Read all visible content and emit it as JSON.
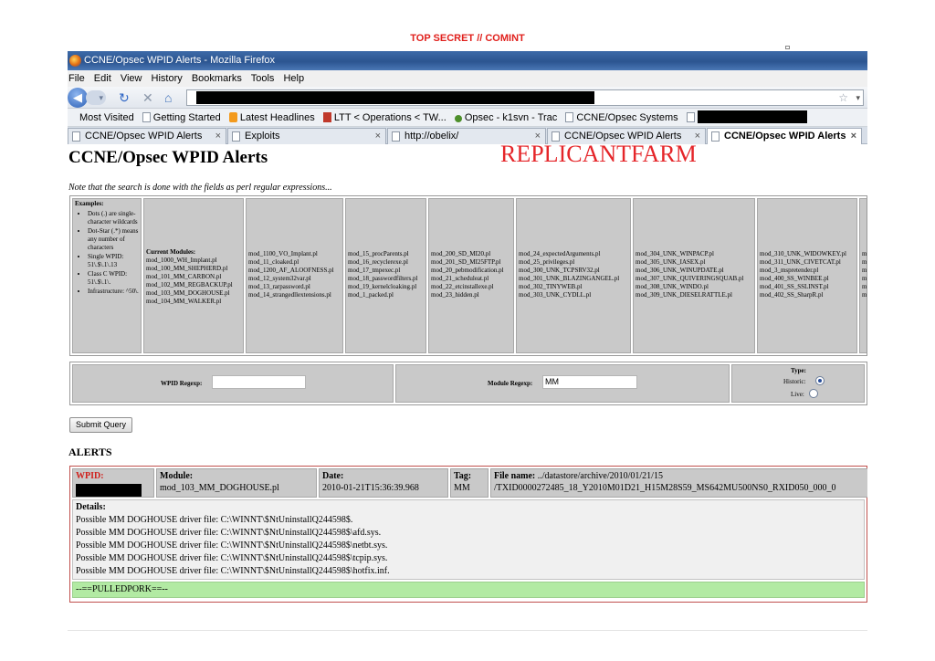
{
  "classification": "TOP SECRET // COMINT",
  "browser": {
    "window_title": "CCNE/Opsec WPID Alerts - Mozilla Firefox",
    "menu": [
      "File",
      "Edit",
      "View",
      "History",
      "Bookmarks",
      "Tools",
      "Help"
    ],
    "bookmarks": [
      "Most Visited",
      "Getting Started",
      "Latest Headlines",
      "LTT < Operations < TW...",
      "Opsec - k1svn - Trac",
      "CCNE/Opsec Systems"
    ],
    "tabs": [
      "CCNE/Opsec WPID Alerts",
      "Exploits",
      "http://obelix/",
      "CCNE/Opsec WPID Alerts",
      "CCNE/Opsec WPID Alerts"
    ],
    "active_tab": 4
  },
  "page": {
    "title": "CCNE/Opsec WPID Alerts",
    "codename": "REPLICANTFARM",
    "note": "Note that the search is done with the fields as perl regular expressions..."
  },
  "examples": {
    "heading": "Examples:",
    "items": [
      "Dots (.) are single-character wildcards",
      "Dot-Star (.*) means any number of characters",
      "Single WPID: 51\\.$\\.1\\.13",
      "Class C WPID: 51\\.$\\.1\\.",
      "Infrastructure: ^50\\."
    ]
  },
  "modules": {
    "heading": "Current Modules:",
    "columns": [
      [
        "mod_1000_WH_Implant.pl",
        "mod_100_MM_SHEPHERD.pl",
        "mod_101_MM_CARBON.pl",
        "mod_102_MM_REGBACKUP.pl",
        "mod_103_MM_DOGHOUSE.pl",
        "mod_104_MM_WALKER.pl"
      ],
      [
        "mod_1100_VO_Implant.pl",
        "mod_11_cloaked.pl",
        "mod_1200_AF_ALOOFNESS.pl",
        "mod_12_system32var.pl",
        "mod_13_rarpassword.pl",
        "mod_14_strangedllextensions.pl"
      ],
      [
        "mod_15_procParents.pl",
        "mod_16_recyclerexe.pl",
        "mod_17_tmpexec.pl",
        "mod_18_passwordfilters.pl",
        "mod_19_kernelcloaking.pl",
        "mod_1_packed.pl"
      ],
      [
        "mod_200_SD_MI20.pl",
        "mod_201_SD_MI25FTP.pl",
        "mod_20_pebmodification.pl",
        "mod_21_scheduleat.pl",
        "mod_22_etcinstallexe.pl",
        "mod_23_hidden.pl"
      ],
      [
        "mod_24_expectedArguments.pl",
        "mod_25_privileges.pl",
        "mod_300_UNK_TCPSRV32.pl",
        "mod_301_UNK_BLAZINGANGEL.pl",
        "mod_302_TINYWEB.pl",
        "mod_303_UNK_CYDLL.pl"
      ],
      [
        "mod_304_UNK_WINPACP.pl",
        "mod_305_UNK_IASEX.pl",
        "mod_306_UNK_WINUPDATE.pl",
        "mod_307_UNK_QUIVERINGSQUAB.pl",
        "mod_308_UNK_WINDO.pl",
        "mod_309_UNK_DIESELRATTLE.pl"
      ],
      [
        "mod_310_UNK_WIDOWKEY.pl",
        "mod_311_UNK_CIVETCAT.pl",
        "mod_3_mspretender.pl",
        "mod_400_SS_WINBEE.pl",
        "mod_401_SS_SSLINST.pl",
        "mod_402_SS_SharpR.pl"
      ],
      [
        "mo",
        "mo",
        "mo",
        "mo",
        "mo",
        "mo"
      ]
    ]
  },
  "search": {
    "wpid_label": "WPID Regexp:",
    "wpid_value": "",
    "module_label": "Module Regexp:",
    "module_value": "MM",
    "type_label": "Type:",
    "historic_label": "Historic:",
    "live_label": "Live:",
    "selected_type": "Historic",
    "submit_label": "Submit Query"
  },
  "alerts": {
    "heading": "ALERTS",
    "items": [
      {
        "wpid_label": "WPID:",
        "module_label": "Module:",
        "module": "mod_103_MM_DOGHOUSE.pl",
        "date_label": "Date:",
        "date": "2010-01-21T15:36:39.968",
        "tag_label": "Tag:",
        "tag": "MM",
        "file_label": "File name:",
        "file_line1": "../datastore/archive/2010/01/21/15",
        "file_line2": "/TXID0000272485_18_Y2010M01D21_H15M28S59_MS642MU500NS0_RXID050_000_0",
        "details_label": "Details:",
        "details": [
          "Possible MM DOGHOUSE driver file: C:\\WINNT\\$NtUninstallQ244598$.",
          "Possible MM DOGHOUSE driver file: C:\\WINNT\\$NtUninstallQ244598$\\afd.sys.",
          "Possible MM DOGHOUSE driver file: C:\\WINNT\\$NtUninstallQ244598$\\netbt.sys.",
          "Possible MM DOGHOUSE driver file: C:\\WINNT\\$NtUninstallQ244598$\\tcpip.sys.",
          "Possible MM DOGHOUSE driver file: C:\\WINNT\\$NtUninstallQ244598$\\hotfix.inf."
        ],
        "footer": "--==PULLEDPORK==--"
      }
    ]
  }
}
